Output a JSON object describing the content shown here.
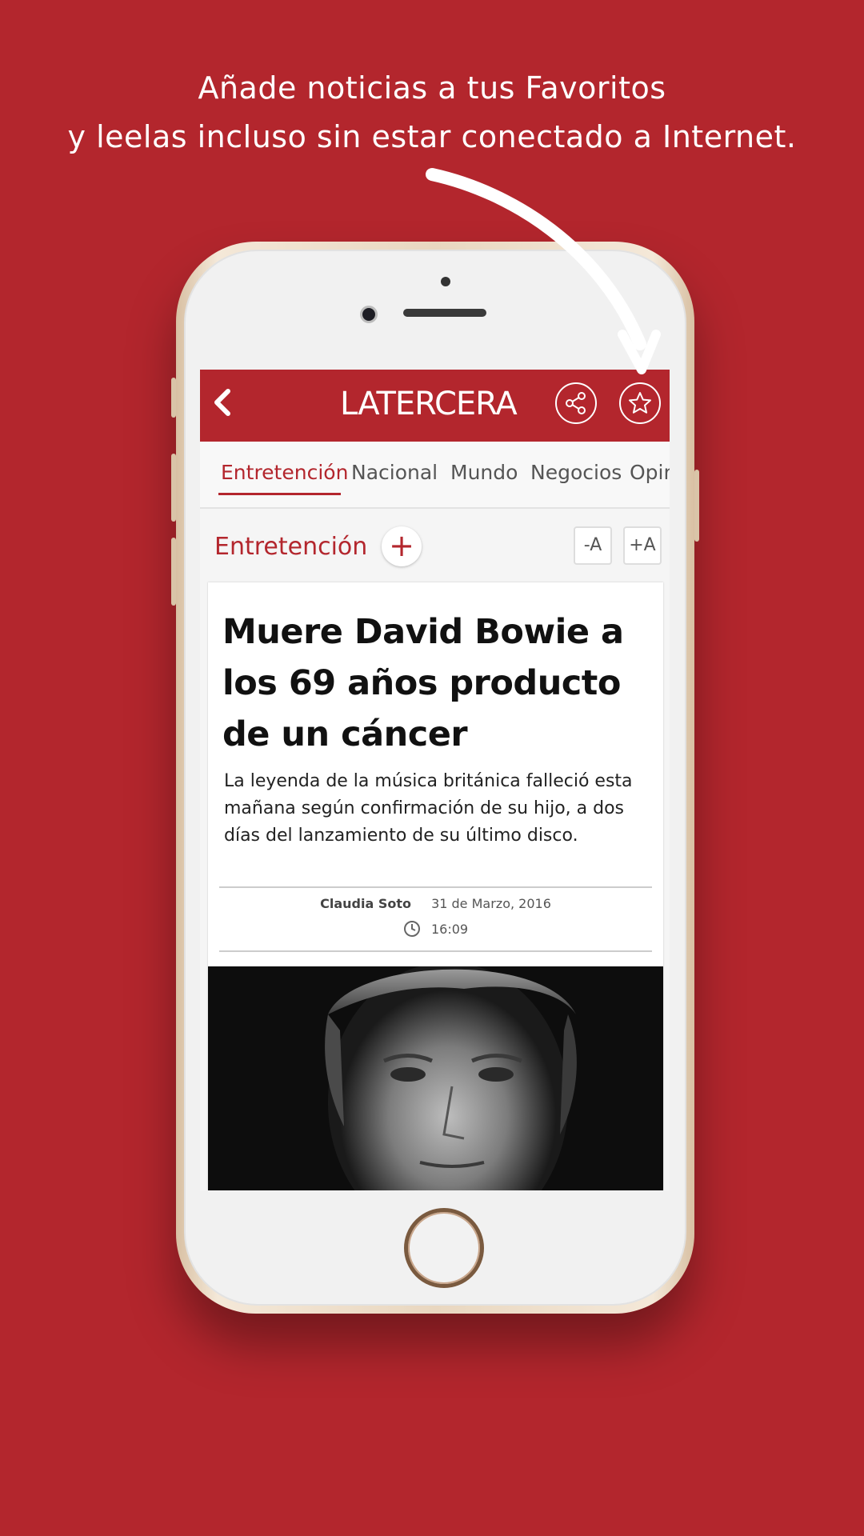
{
  "promo": {
    "line1": "Añade noticias a tus Favoritos",
    "line2": "y leelas incluso sin estar conectado a Internet."
  },
  "header": {
    "logo": "LATERCERA",
    "back_icon": "chevron-left-icon",
    "share_icon": "share-icon",
    "favorite_icon": "star-icon"
  },
  "tabs": [
    {
      "label": "Entretención",
      "active": true
    },
    {
      "label": "Nacional"
    },
    {
      "label": "Mundo"
    },
    {
      "label": "Negocios"
    },
    {
      "label": "Opin"
    }
  ],
  "section": {
    "title": "Entretención",
    "add_label": "+",
    "font_decrease": "-A",
    "font_increase": "+A"
  },
  "article": {
    "headline": "Muere David Bowie a los 69 años producto de un cáncer",
    "summary": "La leyenda de la música británica falleció esta mañana según confirmación de su hijo, a dos días del lanzamiento de su último disco.",
    "author": "Claudia Soto",
    "date": "31 de Marzo, 2016",
    "time": "16:09"
  },
  "colors": {
    "brand_red": "#b3262d",
    "background": "#b3262d"
  }
}
